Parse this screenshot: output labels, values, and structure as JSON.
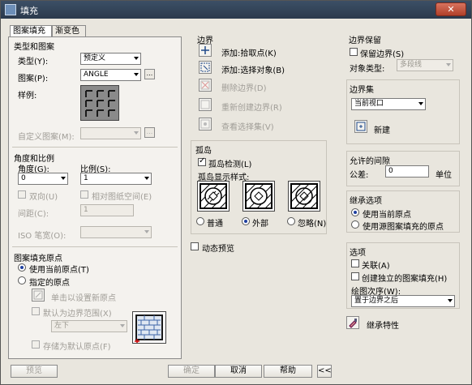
{
  "window": {
    "title": "填充"
  },
  "tabs": [
    "图案填充",
    "渐变色"
  ],
  "type_pattern": {
    "section": "类型和图案",
    "type_label": "类型(Y):",
    "type_value": "预定义",
    "pattern_label": "图案(P):",
    "pattern_value": "ANGLE",
    "sample_label": "样例:",
    "custom_label": "自定义图案(M):",
    "custom_value": ""
  },
  "angle_scale": {
    "section": "角度和比例",
    "angle_label": "角度(G):",
    "angle_value": "0",
    "scale_label": "比例(S):",
    "scale_value": "1",
    "double_label": "双向(U)",
    "relative_label": "相对图纸空间(E)",
    "spacing_label": "间距(C):",
    "spacing_value": "1",
    "iso_label": "ISO 笔宽(O):",
    "iso_value": ""
  },
  "origin": {
    "section": "图案填充原点",
    "use_current": "使用当前原点(T)",
    "specified": "指定的原点",
    "click_set": "单击以设置新原点",
    "default_extents": "默认为边界范围(X)",
    "position_value": "左下",
    "store_default": "存储为默认原点(F)"
  },
  "boundaries": {
    "section": "边界",
    "add_pick": "添加:拾取点(K)",
    "add_select": "添加:选择对象(B)",
    "remove": "删除边界(D)",
    "recreate": "重新创建边界(R)",
    "view_sel": "查看选择集(V)"
  },
  "islands": {
    "section": "孤岛",
    "detect": "孤岛检测(L)",
    "style_label": "孤岛显示样式:",
    "normal": "普通",
    "outer": "外部",
    "ignore": "忽略(N)"
  },
  "preview_check": "动态预览",
  "boundary_retention": {
    "section": "边界保留",
    "retain": "保留边界(S)",
    "object_type_label": "对象类型:",
    "object_type_value": "多段线"
  },
  "boundary_set": {
    "section": "边界集",
    "value": "当前视口",
    "new_label": "新建"
  },
  "gap": {
    "section": "允许的间隙",
    "tol_label": "公差:",
    "tol_value": "0",
    "unit": "单位"
  },
  "inherit_options": {
    "section": "继承选项",
    "use_current": "使用当前原点",
    "use_source": "使用源图案填充的原点"
  },
  "options": {
    "section": "选项",
    "associative": "关联(A)",
    "separate": "创建独立的图案填充(H)",
    "draw_order_label": "绘图次序(W):",
    "draw_order_value": "置于边界之后",
    "inherit_label": "继承特性"
  },
  "buttons": {
    "preview": "预览",
    "ok": "确定",
    "cancel": "取消",
    "help": "帮助",
    "expand": "<<"
  }
}
